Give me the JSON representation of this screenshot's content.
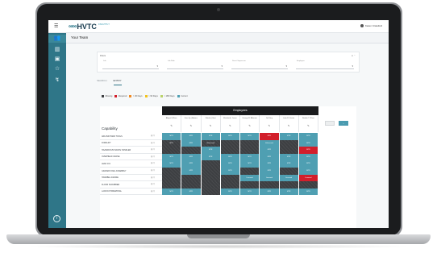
{
  "app": {
    "logo_mark": "∞",
    "logo_text": "HVTC",
    "logo_sub": "INSIGHTS™",
    "user_name": "Karen Crawford",
    "page_title": "Your Team"
  },
  "sidebar": {
    "items": [
      {
        "icon": "team-icon",
        "glyph": "👥"
      },
      {
        "icon": "chart-icon",
        "glyph": "▥"
      },
      {
        "icon": "id-card-icon",
        "glyph": "▣"
      },
      {
        "icon": "people-star-icon",
        "glyph": "☆"
      },
      {
        "icon": "route-icon",
        "glyph": "↯"
      }
    ],
    "info_glyph": "i"
  },
  "filters": {
    "label": "Filters",
    "controls": "⊗ ⌃",
    "selects": [
      {
        "label": "Job",
        "value": ""
      },
      {
        "label": "Job Role",
        "value": ""
      },
      {
        "label": "Direct Supervisor",
        "value": ""
      },
      {
        "label": "Employee",
        "value": ""
      }
    ]
  },
  "tabs": [
    "SEARCH",
    "ENTRY"
  ],
  "active_tab": "ENTRY",
  "legend": [
    {
      "label": "Missing",
      "color": "#3d3f42"
    },
    {
      "label": "Required",
      "color": "#d21f2b"
    },
    {
      "label": "> 30 Days",
      "color": "#f08a24"
    },
    {
      "label": "> 90 Days",
      "color": "#f2c21b"
    },
    {
      "label": "> 180 Days",
      "color": "#b9d26a"
    },
    {
      "label": "Current",
      "color": "#4f9fb2"
    }
  ],
  "matrix": {
    "header": "Employees",
    "capability_title": "Capability",
    "employees": [
      "Abigail | Rhoe",
      "Sam Sy | Adams",
      "Natalie | Hart",
      "Elizabeth | Jones",
      "George B. Alberino",
      "Jeff Guy",
      "Luke R. Foster",
      "Natalie T. Rhoe"
    ],
    "edit_glyph": "✎",
    "save_label": "›",
    "rows": [
      {
        "name": "AIR AND HAND TOOLS",
        "cells": [
          "teal:MTR",
          "teal:MTR",
          "teal:MTR",
          "teal:MTR",
          "teal:MTR",
          "red:MTR",
          "teal:MTR",
          "teal:MTR"
        ]
      },
      {
        "name": "FORKLIFT",
        "cells": [
          "dark:MTR",
          "teal:MTR",
          "dark:Unlicensed",
          "dark:",
          "dark:",
          "teal:Unlicensed",
          "dark:",
          "teal:MTR"
        ]
      },
      {
        "name": "HAZARDOUS WASTE HANDLER",
        "cells": [
          "dark:",
          "dark:",
          "teal:MTR",
          "dark:",
          "dark:",
          "teal:MTR",
          "dark:",
          "red:MTR"
        ]
      },
      {
        "name": "OVERHEAD CRANE",
        "cells": [
          "teal:MTR",
          "teal:MTR",
          "teal:MTR",
          "teal:MTR",
          "teal:MTR",
          "teal:MTR",
          "teal:MTR",
          "teal:MTR"
        ]
      },
      {
        "name": "LEAN 101",
        "cells": [
          "teal:MTR",
          "teal:MTR",
          "dark:",
          "teal:MTR",
          "teal:MTR",
          "teal:MTR",
          "teal:MTR",
          "teal:MTR"
        ]
      },
      {
        "name": "GRAVER FINAL ASSEMBLY",
        "cells": [
          "dark:",
          "teal:MTR",
          "dark:",
          "teal:MTR",
          "dark:",
          "teal:MTR",
          "dark:",
          "teal:MTR"
        ]
      },
      {
        "name": "HANDBE LICENSE",
        "cells": [
          "dark:",
          "dark:",
          "dark:",
          "dark:",
          "teal:Licensed",
          "teal:Licensed",
          "teal:Licensed",
          "red:Licensed"
        ]
      },
      {
        "name": "FLOOR SCRUBBER",
        "cells": [
          "dark:",
          "dark:",
          "dark:",
          "dark:",
          "dark:",
          "dark:",
          "dark:",
          "dark:"
        ]
      },
      {
        "name": "LACKOUT/FREMOVAL",
        "cells": [
          "teal:MTR",
          "teal:MTR",
          "dark:",
          "teal:MTR",
          "teal:MTR",
          "teal:MTR",
          "teal:MTR",
          "teal:MTR"
        ]
      }
    ]
  }
}
